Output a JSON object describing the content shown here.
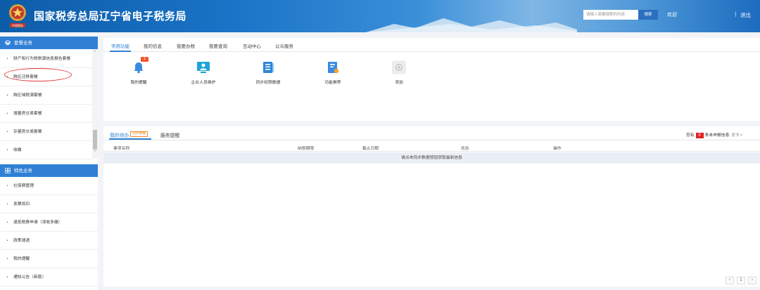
{
  "header": {
    "title": "国家税务总局辽宁省电子税务局",
    "logo_text": "中国税务",
    "search_placeholder": "请输入需要搜索的内容",
    "search_button": "搜索",
    "welcome": "欢迎",
    "separator": "|",
    "logout": "退出"
  },
  "sidebar": {
    "section1": {
      "title": "套餐业务",
      "icon": "package-icon"
    },
    "section1_items": [
      {
        "label": "财产和行为税税源信息报告套餐"
      },
      {
        "label": "跨区迁移套餐"
      },
      {
        "label": "跨区域税源套餐"
      },
      {
        "label": "增量房交易套餐"
      },
      {
        "label": "存量房交易套餐"
      },
      {
        "label": "收缴"
      }
    ],
    "section2": {
      "title": "特色业务",
      "icon": "grid-icon"
    },
    "section2_items": [
      {
        "label": "社保费管理"
      },
      {
        "label": "发票抵扣"
      },
      {
        "label": "退抵税费申请（误收多缴）"
      },
      {
        "label": "政策速递"
      },
      {
        "label": "我的提醒"
      },
      {
        "label": "通知公告（新版）"
      }
    ]
  },
  "top_tabs": [
    {
      "label": "常用功能"
    },
    {
      "label": "我的信息"
    },
    {
      "label": "我要办税"
    },
    {
      "label": "我要查询"
    },
    {
      "label": "互动中心"
    },
    {
      "label": "公众服务"
    }
  ],
  "functions": [
    {
      "label": "我的提醒",
      "icon": "bell-icon",
      "badge": "1"
    },
    {
      "label": "企业人员维护",
      "icon": "user-edit-icon"
    },
    {
      "label": "同步权限数据",
      "icon": "sync-data-icon"
    },
    {
      "label": "功能推荐",
      "icon": "recommend-icon"
    },
    {
      "label": "添加",
      "icon": "add-icon"
    }
  ],
  "todo": {
    "tab_active": "我的待办",
    "sync_tag": "同步数据",
    "tab2": "服务提醒",
    "summary_prefix": "您有",
    "count": "0",
    "summary_suffix": "条未申报信息",
    "more": "更多>",
    "columns": [
      "事项名称",
      "纳税期限",
      "截止日期",
      "状态",
      "操作"
    ],
    "empty_message": "请点击同步数据按钮获取最新信息"
  },
  "pagination": {
    "prev": "‹",
    "page": "1",
    "next": "›"
  },
  "colors": {
    "accent": "#2f80d5",
    "badge": "#f0562f",
    "danger": "#e02020"
  }
}
